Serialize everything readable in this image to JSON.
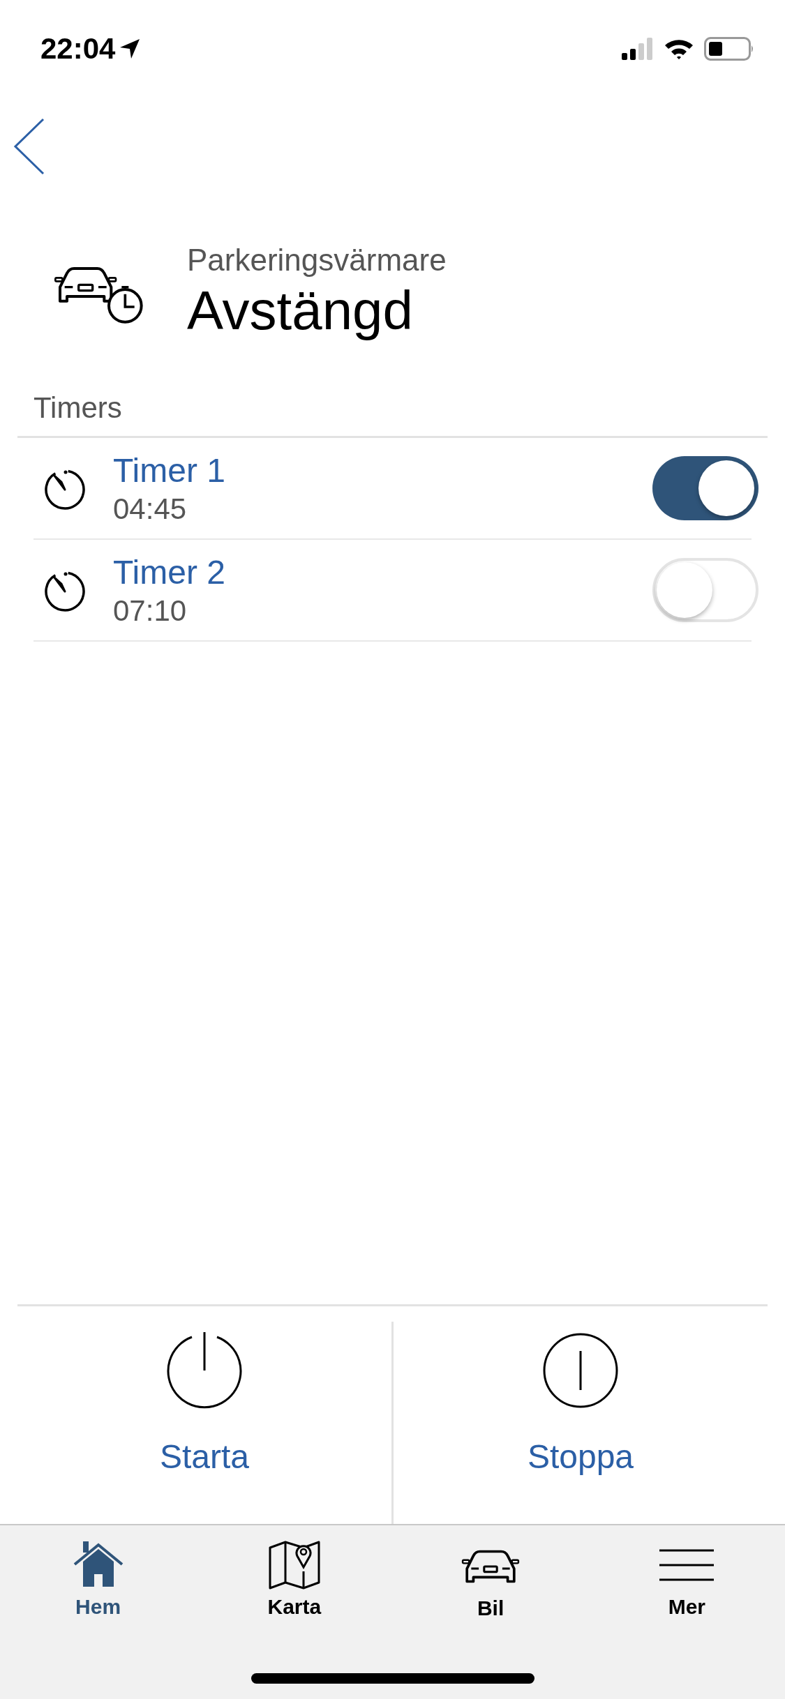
{
  "status_bar": {
    "time": "22:04"
  },
  "header": {
    "title": "Parkeringsvärmare",
    "status": "Avstängd"
  },
  "section": {
    "title": "Timers"
  },
  "timers": [
    {
      "name": "Timer 1",
      "time": "04:45",
      "on": true
    },
    {
      "name": "Timer 2",
      "time": "07:10",
      "on": false
    }
  ],
  "actions": [
    {
      "label": "Starta",
      "kind": "start"
    },
    {
      "label": "Stoppa",
      "kind": "stop"
    }
  ],
  "tab_bar": [
    {
      "label": "Hem",
      "kind": "home",
      "selected": true
    },
    {
      "label": "Karta",
      "kind": "map",
      "selected": false
    },
    {
      "label": "Bil",
      "kind": "car",
      "selected": false
    },
    {
      "label": "Mer",
      "kind": "menu",
      "selected": false
    }
  ]
}
